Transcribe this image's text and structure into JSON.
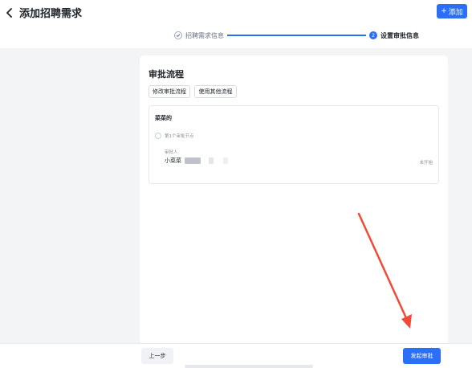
{
  "header": {
    "back_title": "添加招聘需求",
    "add_button_label": "添加"
  },
  "steps": [
    {
      "label": "招聘需求信息",
      "status": "done"
    },
    {
      "label": "设置审批信息",
      "number": "2",
      "status": "active"
    }
  ],
  "card": {
    "title": "审批流程",
    "buttons": {
      "modify": "修改审批流程",
      "use_other": "使用其他流程"
    },
    "flow": {
      "name": "菜菜的",
      "node_label": "第1个审批节点",
      "approver_label": "审批人",
      "approver_name": "小菜菜",
      "status": "未开始"
    }
  },
  "footer": {
    "prev_label": "上一步",
    "submit_label": "发起审批"
  },
  "colors": {
    "primary": "#2b6ff7",
    "annotation_arrow": "#f24a36"
  }
}
